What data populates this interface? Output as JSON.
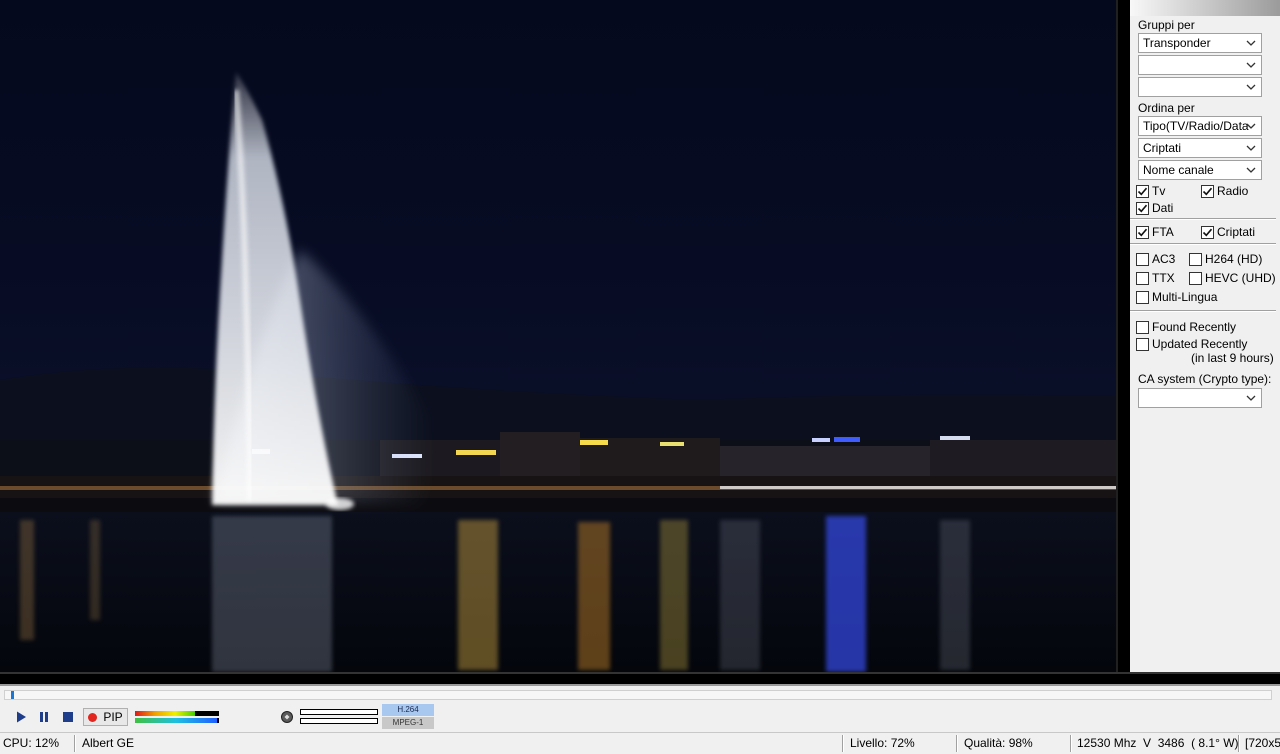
{
  "panel": {
    "group_label": "Gruppi per",
    "group_dropdowns": [
      "Transponder",
      "",
      ""
    ],
    "sort_label": "Ordina per",
    "sort_dropdowns": [
      "Tipo(TV/Radio/Data",
      "Criptati",
      "Nome canale"
    ],
    "checkboxes": {
      "tv": {
        "label": "Tv",
        "checked": true
      },
      "radio": {
        "label": "Radio",
        "checked": true
      },
      "dati": {
        "label": "Dati",
        "checked": true
      },
      "fta": {
        "label": "FTA",
        "checked": true
      },
      "criptati": {
        "label": "Criptati",
        "checked": true
      },
      "ac3": {
        "label": "AC3",
        "checked": false
      },
      "h264": {
        "label": "H264 (HD)",
        "checked": false
      },
      "ttx": {
        "label": "TTX",
        "checked": false
      },
      "hevc": {
        "label": "HEVC (UHD)",
        "checked": false
      },
      "multilingua": {
        "label": "Multi-Lingua",
        "checked": false
      },
      "found_recently": {
        "label": "Found Recently",
        "checked": false
      },
      "updated_recently": {
        "label": "Updated Recently",
        "checked": false
      }
    },
    "updated_note": "(in last 9 hours)",
    "ca_label": "CA system (Crypto type):",
    "ca_dropdown": ""
  },
  "controls": {
    "pip_label": "PIP",
    "codec_video": "H.264",
    "codec_audio": "MPEG-1",
    "seek_position": 0.003,
    "meter_top_level": 0.72,
    "meter_bottom_level": 0.98
  },
  "status": {
    "cpu": "CPU: 12%",
    "channel": "Albert GE",
    "livello": "Livello: 72%",
    "qualita": "Qualità: 98%",
    "frequency": "12530 Mhz  V  3486  ( 8.1° W)",
    "resolution": "[720x5"
  },
  "colors": {
    "accent": "#1a78d4",
    "record": "#e0261f",
    "video_bg": "#05091d"
  }
}
